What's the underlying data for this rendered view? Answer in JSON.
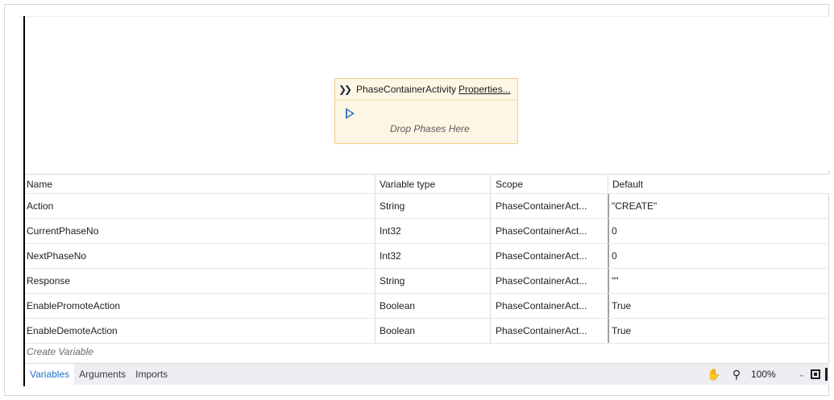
{
  "designer": {
    "activity": {
      "title": "PhaseContainerActivity",
      "properties_link": "Properties...",
      "drop_hint": "Drop Phases Here",
      "icon": "double-chevron-right-icon",
      "start_icon": "play-outline-icon"
    }
  },
  "variables_grid": {
    "columns": [
      "Name",
      "Variable type",
      "Scope",
      "Default"
    ],
    "rows": [
      {
        "name": "Action",
        "type": "String",
        "scope": "PhaseContainerAct...",
        "default": "\"CREATE\""
      },
      {
        "name": "CurrentPhaseNo",
        "type": "Int32",
        "scope": "PhaseContainerAct...",
        "default": "0"
      },
      {
        "name": "NextPhaseNo",
        "type": "Int32",
        "scope": "PhaseContainerAct...",
        "default": "0"
      },
      {
        "name": "Response",
        "type": "String",
        "scope": "PhaseContainerAct...",
        "default": "\"\""
      },
      {
        "name": "EnablePromoteAction",
        "type": "Boolean",
        "scope": "PhaseContainerAct...",
        "default": "True"
      },
      {
        "name": "EnableDemoteAction",
        "type": "Boolean",
        "scope": "PhaseContainerAct...",
        "default": "True"
      }
    ],
    "create_placeholder": "Create Variable"
  },
  "statusbar": {
    "tabs": [
      "Variables",
      "Arguments",
      "Imports"
    ],
    "active_tab": "Variables",
    "zoom": "100%",
    "icons": [
      "hand-pan-icon",
      "magnifier-icon",
      "fit-to-screen-icon"
    ]
  },
  "colors": {
    "activity_fill": "#fdf6e4",
    "activity_border": "#f0cd84",
    "accent": "#1f6fc5"
  }
}
